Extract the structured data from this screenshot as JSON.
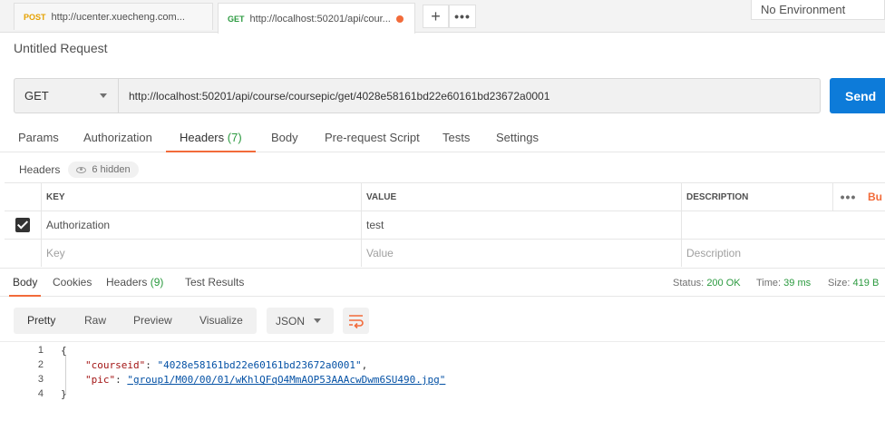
{
  "tabs": [
    {
      "method": "POST",
      "method_color": "#e5a100",
      "url": "http://ucenter.xuecheng.com..."
    },
    {
      "method": "GET",
      "method_color": "#2b9a3f",
      "url": "http://localhost:50201/api/cour..."
    }
  ],
  "tab_actions": {
    "add_icon": "plus-icon",
    "more_icon": "more-icon"
  },
  "environment": "No Environment",
  "request_title": "Untitled Request",
  "request": {
    "method": "GET",
    "url": "http://localhost:50201/api/course/coursepic/get/4028e58161bd22e60161bd23672a0001",
    "send_label": "Send"
  },
  "request_tabs": [
    {
      "label": "Params",
      "count": ""
    },
    {
      "label": "Authorization",
      "count": ""
    },
    {
      "label": "Headers",
      "count": "(7)"
    },
    {
      "label": "Body",
      "count": ""
    },
    {
      "label": "Pre-request Script",
      "count": ""
    },
    {
      "label": "Tests",
      "count": ""
    },
    {
      "label": "Settings",
      "count": ""
    }
  ],
  "headers_section": {
    "label": "Headers",
    "hidden": "6 hidden"
  },
  "table": {
    "columns": [
      "KEY",
      "VALUE",
      "DESCRIPTION"
    ],
    "bulk_edit": "Bu",
    "rows": [
      {
        "checked": true,
        "key": "Authorization",
        "value": "test",
        "description": ""
      }
    ],
    "placeholder": {
      "key": "Key",
      "value": "Value",
      "description": "Description"
    }
  },
  "response_tabs": [
    {
      "label": "Body",
      "count": ""
    },
    {
      "label": "Cookies",
      "count": ""
    },
    {
      "label": "Headers",
      "count": "(9)"
    },
    {
      "label": "Test Results",
      "count": ""
    }
  ],
  "response_status": {
    "status_label": "Status:",
    "status_value": "200 OK",
    "time_label": "Time:",
    "time_value": "39 ms",
    "size_label": "Size:",
    "size_value": "419 B"
  },
  "view_modes": [
    "Pretty",
    "Raw",
    "Preview",
    "Visualize"
  ],
  "format": "JSON",
  "colors": {
    "accent": "#f26b3a",
    "send": "#0d7bd9",
    "success": "#2b9a3f"
  },
  "code_lines": [
    {
      "n": "1",
      "open": "{"
    },
    {
      "n": "2",
      "key": "\"courseid\"",
      "sep": ": ",
      "value": "\"4028e58161bd22e60161bd23672a0001\"",
      "tail": ","
    },
    {
      "n": "3",
      "key": "\"pic\"",
      "sep": ": ",
      "value": "\"group1/M00/00/01/wKhlQFqO4MmAOP53AAAcwDwm6SU490.jpg\"",
      "tail": ""
    },
    {
      "n": "4",
      "close": "}"
    }
  ]
}
